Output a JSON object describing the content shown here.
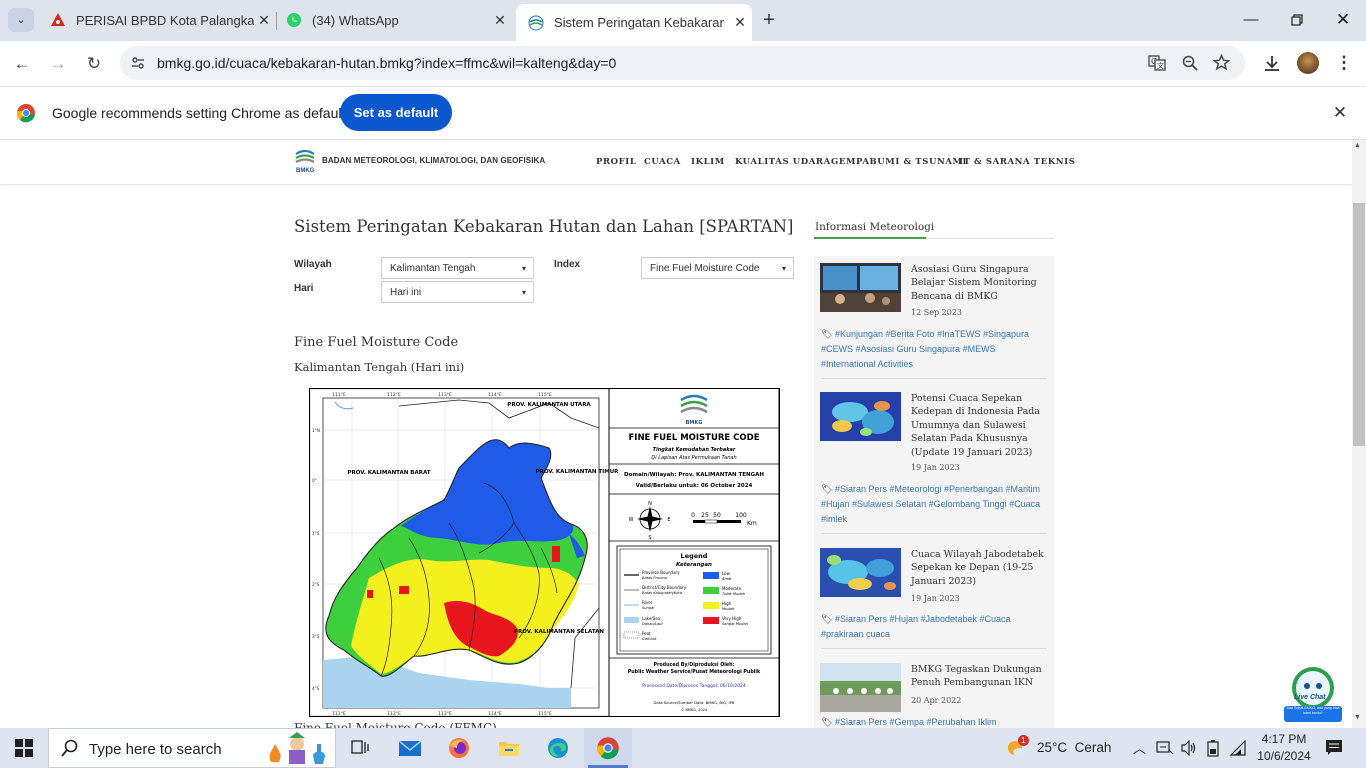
{
  "browser": {
    "tabs": [
      {
        "title": "PERISAI BPBD Kota Palangka Ra",
        "close": "✕"
      },
      {
        "title": "(34) WhatsApp",
        "close": "✕"
      },
      {
        "title": "Sistem Peringatan Kebakaran H",
        "close": "✕"
      }
    ],
    "new_tab": "+",
    "url": "bmkg.go.id/cuaca/kebakaran-hutan.bmkg?index=ffmc&wil=kalteng&day=0",
    "infobar": {
      "message": "Google recommends setting Chrome as default",
      "button": "Set as default"
    }
  },
  "site": {
    "org_name": "BADAN METEOROLOGI, KLIMATOLOGI, DAN GEOFISIKA",
    "logo_text": "BMKG",
    "nav": [
      "PROFIL",
      "CUACA",
      "IKLIM",
      "KUALITAS UDARA",
      "GEMPABUMI & TSUNAMI",
      "IT & SARANA TEKNIS"
    ]
  },
  "main": {
    "title": "Sistem Peringatan Kebakaran Hutan dan Lahan [SPARTAN]",
    "filters": {
      "wilayah_label": "Wilayah",
      "wilayah_value": "Kalimantan Tengah",
      "hari_label": "Hari",
      "hari_value": "Hari ini",
      "index_label": "Index",
      "index_value": "Fine Fuel Moisture Code"
    },
    "section_title": "Fine Fuel Moisture Code",
    "subtitle": "Kalimantan Tengah (Hari ini)",
    "cut_text": "Fine Fuel Moisture Code (FFMC)"
  },
  "map": {
    "logo_text": "BMKG",
    "title": "FINE FUEL MOISTURE CODE",
    "subtitle1": "Tingkat Kemudahan Terbakar",
    "subtitle2": "Di Lapisan Atas Permukaan Tanah",
    "domain": "Domain/Wilayah: Prov. KALIMANTAN TENGAH",
    "valid": "Valid/Berlaku untuk: 06 October 2024",
    "compass": {
      "n": "N",
      "s": "S",
      "e": "E",
      "w": "W"
    },
    "scale": {
      "labels": [
        "0",
        "25",
        "50",
        "100"
      ],
      "unit": "Km"
    },
    "lon_ticks": [
      "111°E",
      "112°E",
      "113°E",
      "114°E",
      "115°E"
    ],
    "lat_ticks": [
      "1°N",
      "0°",
      "1°S",
      "2°S",
      "3°S",
      "4°S"
    ],
    "provinces": [
      "PROV. KALIMANTAN UTARA",
      "PROV. KALIMANTAN BARAT",
      "PROV. KALIMANTAN TIMUR",
      "PROV. KALIMANTAN SELATAN"
    ],
    "legend": {
      "title": "Legend",
      "subtitle": "Keterangan",
      "items": [
        {
          "label": "Province Boundary",
          "sub": "Batas Provinsi"
        },
        {
          "label": "District/City Boundary",
          "sub": "Batas Kabupaten/Kota"
        },
        {
          "label": "River",
          "sub": "Sungai"
        },
        {
          "label": "Lake/Sea",
          "sub": "Danau/Laut"
        },
        {
          "label": "Peat",
          "sub": "Gambut"
        }
      ],
      "classes": [
        {
          "label": "Low",
          "sub": "Amat",
          "color": "#1f5be8"
        },
        {
          "label": "Moderate",
          "sub": "Tidak Mudah",
          "color": "#3ecf3e"
        },
        {
          "label": "High",
          "sub": "Mudah",
          "color": "#f3f01e"
        },
        {
          "label": "Very High",
          "sub": "Sangat Mudah",
          "color": "#e8141e"
        }
      ]
    },
    "produced_by": "Produced By/Diproduksi Oleh:",
    "producer": "Public Weather Service/Pusat Meteorologi Publik",
    "processed": "Processed Date/Diproses Tanggal: 06/10/2024",
    "source": "Data Source/Sumber Data: BMKG, BIG, IPB",
    "copyright": "© BMKG, 2024"
  },
  "sidebar": {
    "heading": "Informasi Meteorologi",
    "news": [
      {
        "title": "Asosiasi Guru Singapura Belajar Sistem Monitoring Bencana di BMKG",
        "date": "12 Sep 2023",
        "tags": "#Kunjungan #Berita Foto #InaTEWS #Singapura #CEWS #Asosiasi Guru Singapura #MEWS #International Activities"
      },
      {
        "title": "Potensi Cuaca Sepekan Kedepan di Indonesia Pada Umumnya dan Sulawesi Selatan Pada Khususnya (Update 19 Januari 2023)",
        "date": "19 Jan 2023",
        "tags": "#Siaran Pers #Meteorologi #Penerbangan #Maritim #Hujan #Sulawesi Selatan #Gelombang Tinggi #Cuaca #imlek"
      },
      {
        "title": "Cuaca Wilayah Jabodetabek Sepekan ke Depan (19-25 Januari 2023)",
        "date": "19 Jan 2023",
        "tags": "#Siaran Pers #Hujan #Jabodetabek #Cuaca #prakiraan cuaca"
      },
      {
        "title": "BMKG Tegaskan Dukungan Penuh Pembangunan IKN",
        "date": "20 Apr 2022",
        "tags": "#Siaran Pers #Gempa #Perubahan Iklim"
      }
    ]
  },
  "live_chat": {
    "title": "Live Chat",
    "caption": "Ada Sobat BMKG, ada yang bisa kami bantu?"
  },
  "taskbar": {
    "search_placeholder": "Type here to search",
    "weather": "25°C  Cerah",
    "weather_badge": "1",
    "time": "4:17 PM",
    "date": "10/6/2024"
  },
  "colors": {
    "accent": "#0b57d0",
    "tabbar": "#dfe3eb",
    "link": "#3a76b0"
  }
}
